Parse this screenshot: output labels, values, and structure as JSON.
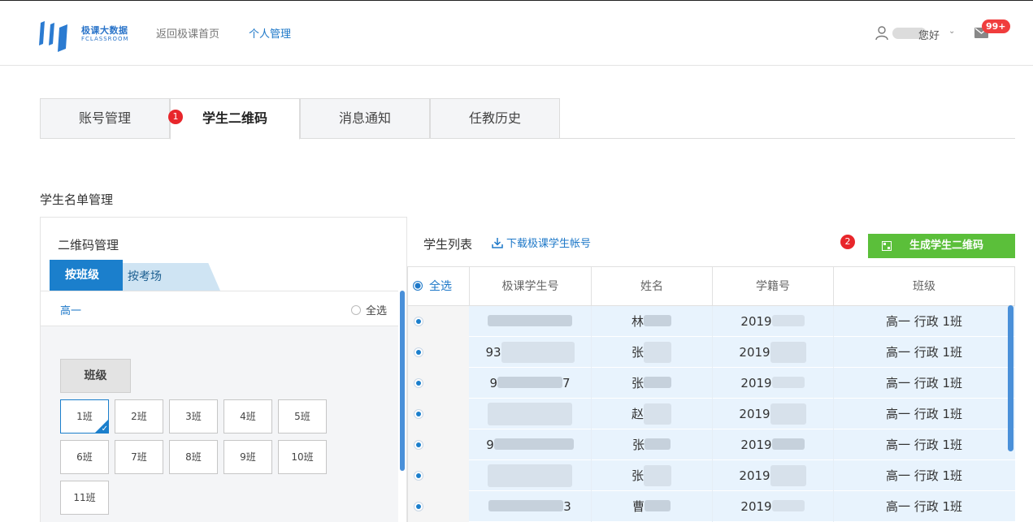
{
  "header": {
    "logo_cn": "极课大数据",
    "logo_en": "FCLASSROOM",
    "nav_home": "返回极课首页",
    "nav_personal": "个人管理",
    "user_greeting": "您好",
    "mail_badge": "99+"
  },
  "tabs": [
    {
      "label": "账号管理"
    },
    {
      "label": "学生二维码"
    },
    {
      "label": "消息通知"
    },
    {
      "label": "任教历史"
    }
  ],
  "steps": {
    "one": "1",
    "two": "2"
  },
  "section_title": "学生名单管理",
  "qr_panel": {
    "title": "二维码管理",
    "subtab_active": "按班级",
    "subtab_inactive": "按考场",
    "grade": "高一",
    "select_all": "全选",
    "class_header": "班级",
    "classes": [
      "1班",
      "2班",
      "3班",
      "4班",
      "5班",
      "6班",
      "7班",
      "8班",
      "9班",
      "10班",
      "11班"
    ]
  },
  "student_panel": {
    "title": "学生列表",
    "download_label": "下载极课学生帐号",
    "generate_label": "生成学生二维码",
    "columns": [
      "全选",
      "极课学生号",
      "姓名",
      "学籍号",
      "班级"
    ],
    "rows": [
      {
        "id": "",
        "name": "林",
        "reg": "2019",
        "class": "高一 行政 1班"
      },
      {
        "id": "93",
        "name": "张",
        "reg": "2019",
        "class": "高一 行政 1班"
      },
      {
        "id": "9",
        "id_tail": "7",
        "name": "张",
        "reg": "2019",
        "class": "高一 行政 1班"
      },
      {
        "id": "",
        "name": "赵",
        "reg": "2019",
        "class": "高一 行政 1班"
      },
      {
        "id": "9",
        "name": "张",
        "reg": "2019",
        "class": "高一 行政 1班"
      },
      {
        "id": "",
        "name": "张",
        "reg": "2019",
        "class": "高一 行政 1班"
      },
      {
        "id": "",
        "id_tail": "3",
        "name": "曹",
        "reg": "2019",
        "class": "高一 行政 1班"
      }
    ]
  },
  "colors": {
    "accent": "#1b7fcc",
    "generate_button": "#5bbf3a",
    "badge": "#e8262b"
  }
}
